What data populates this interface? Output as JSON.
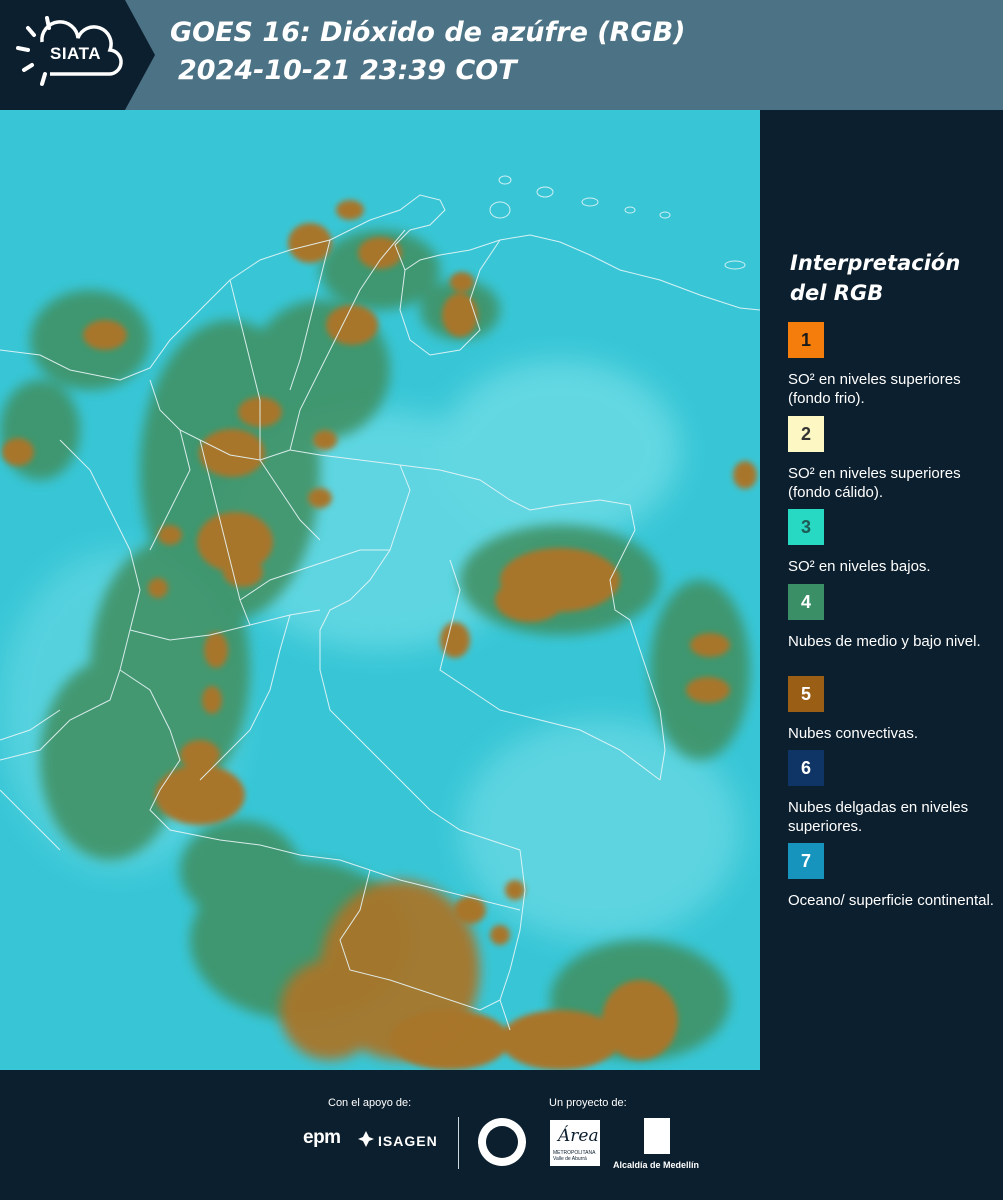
{
  "header": {
    "logo_text": "SIATA",
    "title_line1": "GOES 16: Dióxido de azúfre (RGB)",
    "title_line2": "2024-10-21 23:39 COT"
  },
  "legend": {
    "title_line1": "Interpretación",
    "title_line2": "del RGB",
    "items": [
      {
        "number": "1",
        "color": "#f57d0b",
        "text_color": "#1a1a1a",
        "label": "SO² en niveles superiores (fondo frio)."
      },
      {
        "number": "2",
        "color": "#fdf7c3",
        "text_color": "#333333",
        "label": "SO² en niveles superiores (fondo cálido)."
      },
      {
        "number": "3",
        "color": "#27d9c2",
        "text_color": "#1f5b55",
        "label": "SO² en niveles bajos."
      },
      {
        "number": "4",
        "color": "#3a8f66",
        "text_color": "#ffffff",
        "label": "Nubes de medio y bajo nivel."
      },
      {
        "number": "5",
        "color": "#9a5e15",
        "text_color": "#ffffff",
        "label": "Nubes convectivas."
      },
      {
        "number": "6",
        "color": "#0f3566",
        "text_color": "#ffffff",
        "label": "Nubes delgadas en niveles superiores."
      },
      {
        "number": "7",
        "color": "#1794be",
        "text_color": "#ffffff",
        "label": "Oceano/ superficie continental."
      }
    ]
  },
  "footer": {
    "support_label": "Con el apoyo de:",
    "project_label": "Un proyecto de:",
    "epm": "epm",
    "isagen": "ISAGEN",
    "area_logo": "Área",
    "area_sub": "METROPOLITANA Valle de Aburrá",
    "alcaldia": "Alcaldía de Medellín"
  },
  "map": {
    "ocean_color": "#37c5d5",
    "land_color": "#5fd8e4",
    "low_cloud_color": "#3f8f5e",
    "convective_color": "#a8762b"
  }
}
